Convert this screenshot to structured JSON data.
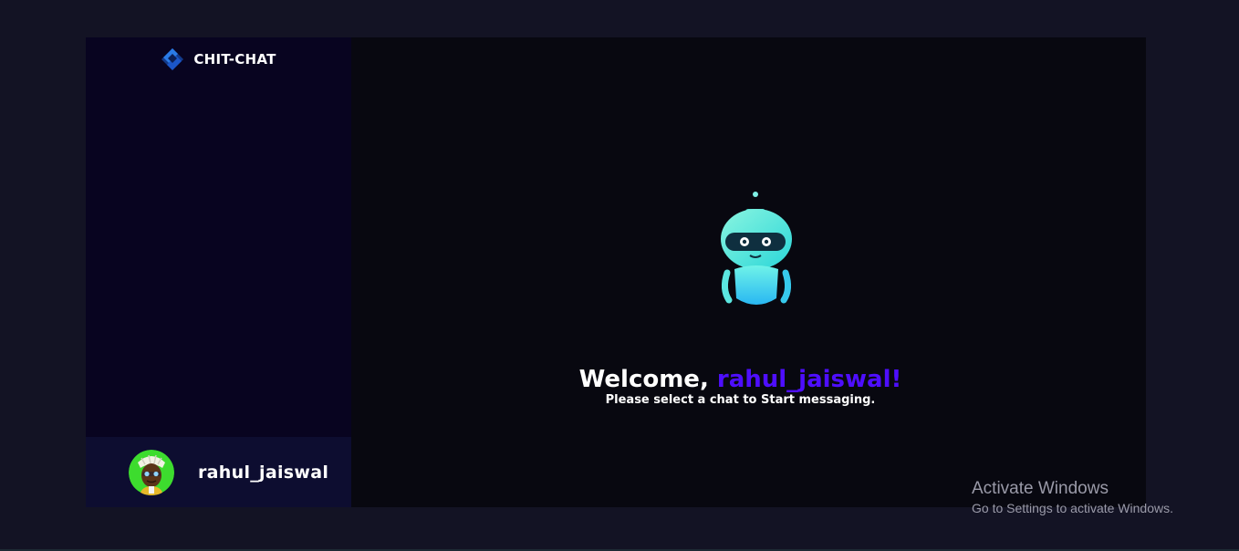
{
  "brand": {
    "name": "CHIT-CHAT",
    "logo_icon": "diamond-logo-icon",
    "logo_color": "#1e63d8"
  },
  "current_user": {
    "username": "rahul_jaiswal",
    "avatar_icon": "user-avatar-icon",
    "avatar_bg": "#3ddc2e"
  },
  "welcome": {
    "prefix": "Welcome, ",
    "username": "rahul_jaiswal!",
    "subtitle": "Please select a chat to Start messaging.",
    "accent_color": "#4e0eff",
    "illustration_icon": "robot-icon"
  },
  "watermark": {
    "title": "Activate Windows",
    "subtitle": "Go to Settings to activate Windows."
  },
  "colors": {
    "page_bg": "#131324",
    "sidebar_bg": "#080420",
    "current_user_bg": "#0d0d30",
    "chat_bg": "#080810"
  }
}
